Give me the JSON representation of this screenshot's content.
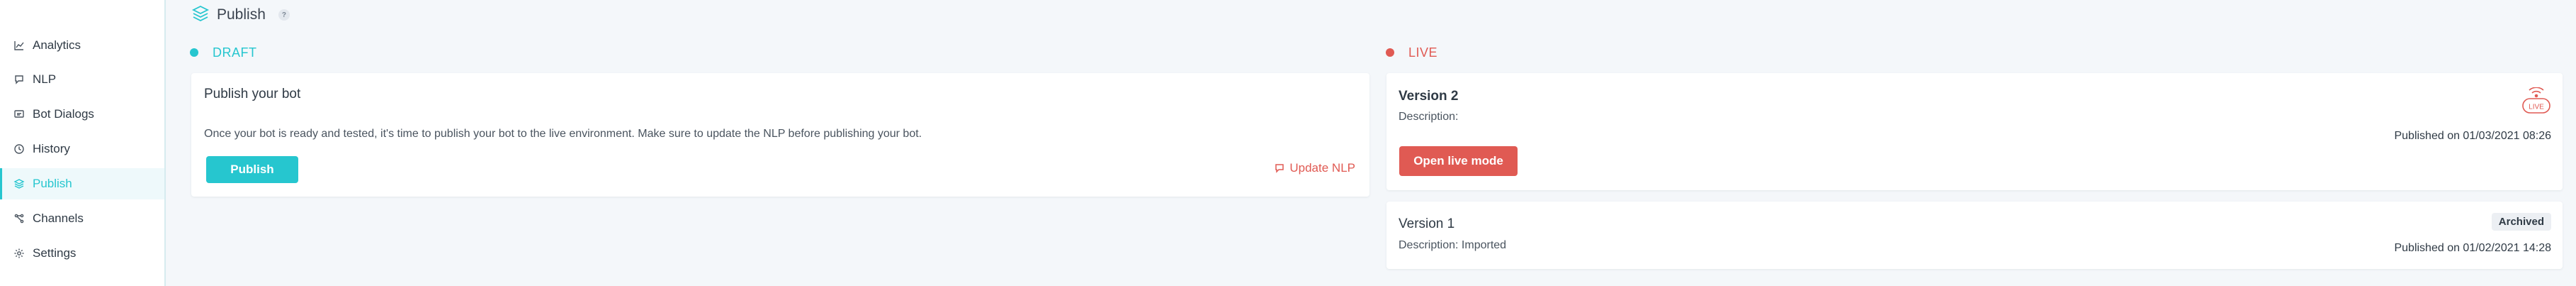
{
  "sidebar": {
    "items": [
      {
        "label": "Analytics",
        "icon": "chart-line-icon"
      },
      {
        "label": "NLP",
        "icon": "chat-bubble-icon"
      },
      {
        "label": "Bot Dialogs",
        "icon": "dialog-icon"
      },
      {
        "label": "History",
        "icon": "clock-icon"
      },
      {
        "label": "Publish",
        "icon": "layers-icon",
        "active": true
      },
      {
        "label": "Channels",
        "icon": "channels-icon"
      },
      {
        "label": "Settings",
        "icon": "gear-icon"
      }
    ]
  },
  "header": {
    "title": "Publish",
    "help": "?"
  },
  "draft": {
    "label": "DRAFT",
    "color": "#26c6cf",
    "card_title": "Publish your bot",
    "description": "Once your bot is ready and tested, it's time to publish your bot to the live environment. Make sure to update the NLP before publishing your bot.",
    "publish_label": "Publish",
    "update_nlp_label": "Update NLP"
  },
  "live": {
    "label": "LIVE",
    "color": "#e05a53",
    "live_badge": "LIVE",
    "current": {
      "title": "Version 2",
      "description": "Description:",
      "open_label": "Open live mode",
      "published": "Published on 01/03/2021 08:26"
    },
    "archived": {
      "title": "Version 1",
      "description": "Description: Imported",
      "badge": "Archived",
      "published": "Published on 01/02/2021 14:28"
    }
  }
}
